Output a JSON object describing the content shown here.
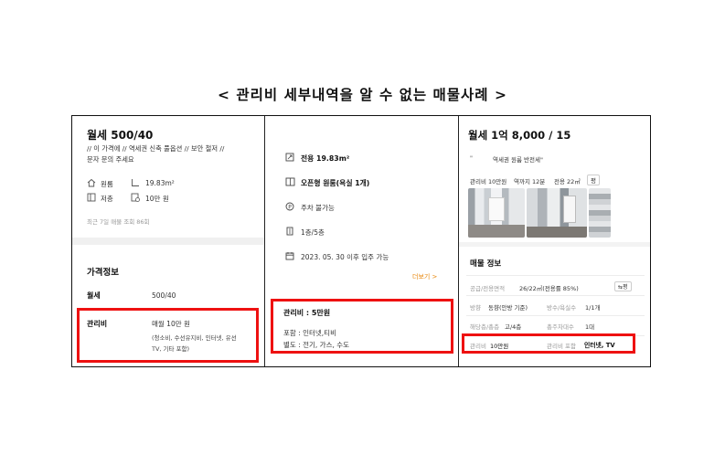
{
  "page_title": "< 관리비 세부내역을 알 수 없는 매물사례 >",
  "panel1": {
    "price": "월세 500/40",
    "desc_line1": "// 이 가격에 // 역세권 신축 풀옵션 // 보안 철저 //",
    "desc_line2": "문자 문의 주세요",
    "room_type": "원룸",
    "area": "19.83m²",
    "floor": "저층",
    "fee_short": "10만 원",
    "views": "최근 7일 매물 조회 86회",
    "section_title": "가격정보",
    "rent_label": "월세",
    "rent_value": "500/40",
    "fee_label": "관리비",
    "fee_value": "매월 10만 원",
    "fee_detail_line1": "(청소비, 수선유지비, 인터넷, 유선",
    "fee_detail_line2": "TV, 기타 포함)"
  },
  "panel2": {
    "area": "전용 19.83m²",
    "room": "오픈형 원룸(욕실 1개)",
    "parking": "주차 불가능",
    "floor": "1층/5층",
    "move_in": "2023. 05. 30 이후 입주 가능",
    "more": "더보기 >",
    "fee_title": "관리비 : 5만원",
    "fee_includes": "포함 : 인터넷,티비",
    "fee_separate": "별도 : 전기, 가스, 수도"
  },
  "panel3": {
    "price": "월세 1억 8,000 / 15",
    "quote_mark": "\"",
    "subtitle": "역세권 원룸 반전세\"",
    "tag_fee": "관리비 10만원",
    "tag_station": "역까지 12분",
    "tag_area": "전용 22㎡",
    "tag_unit": "평",
    "section_title": "매물 정보",
    "row1_label": "공급/전용면적",
    "row1_value": "26/22㎡(전용률 85%)",
    "row1_toggle": "평",
    "row2_label": "방향",
    "row2_value": "동향(안방 기준)",
    "row2_label2": "방수/욕실수",
    "row2_value2": "1/1개",
    "row3_label": "해당층/총층",
    "row3_value": "고/4층",
    "row3_label2": "총주차대수",
    "row3_value2": "1대",
    "row4_label": "관리비",
    "row4_value": "10만원",
    "row4_label2": "관리비 포함",
    "row4_value2": "인터넷, TV"
  },
  "colors": {
    "highlight": "#e11111",
    "more_link": "#e8870b",
    "border": "#111111"
  },
  "icons": [
    "home-icon",
    "area-icon",
    "floor-icon",
    "fee-icon",
    "size-icon",
    "book-icon",
    "parking-icon",
    "building-icon",
    "calendar-icon",
    "swap-icon"
  ]
}
